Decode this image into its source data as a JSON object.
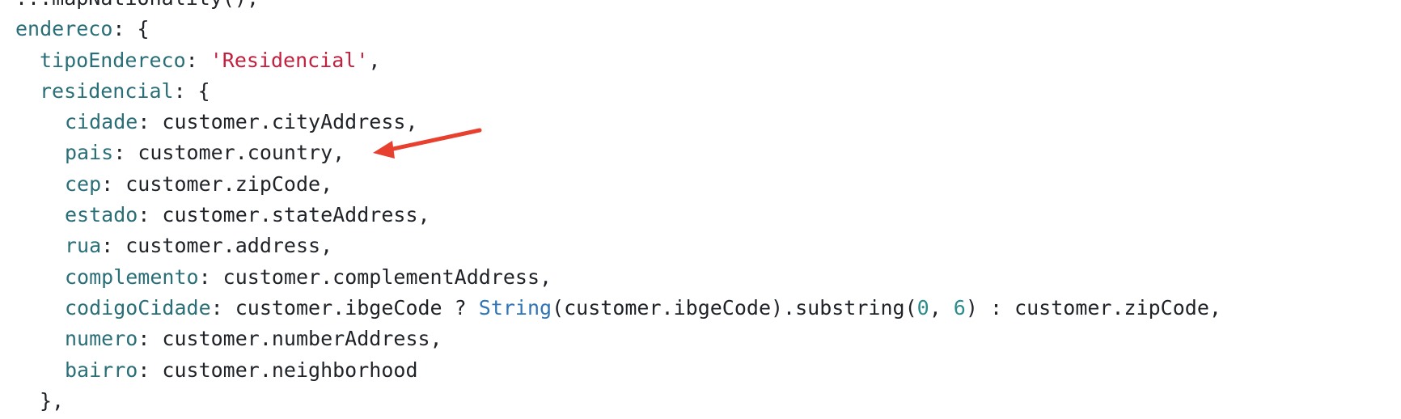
{
  "code_lines": [
    {
      "top_line": "...mapNationality(),"
    },
    {
      "key": "endereco",
      "rest": ": {"
    },
    {
      "key": "tipoEndereco",
      "sep": ": ",
      "string": "'Residencial'",
      "end": ","
    },
    {
      "key": "residencial",
      "rest": ": {"
    },
    {
      "key": "cidade",
      "rest": ": customer.cityAddress,"
    },
    {
      "key": "pais",
      "rest": ": customer.country,"
    },
    {
      "key": "cep",
      "rest": ": customer.zipCode,"
    },
    {
      "key": "estado",
      "rest": ": customer.stateAddress,"
    },
    {
      "key": "rua",
      "rest": ": customer.address,"
    },
    {
      "key": "complemento",
      "rest": ": customer.complementAddress,"
    },
    {
      "key": "codigoCidade",
      "part1": ": customer.ibgeCode ? ",
      "type": "String",
      "part2": "(customer.ibgeCode).substring(",
      "num1": "0",
      "comma": ", ",
      "num2": "6",
      "part3": ") : customer.zipCode,"
    },
    {
      "key": "numero",
      "rest": ": customer.numberAddress,"
    },
    {
      "key": "bairro",
      "rest": ": customer.neighborhood"
    },
    {
      "rest": "},"
    }
  ],
  "colors": {
    "property": "#2a6f78",
    "string": "#c3203f",
    "number": "#2a8c8c",
    "type": "#2f74b5",
    "text": "#1f2328",
    "arrow": "#e8402f"
  },
  "annotations": {
    "arrow_icon": "red-arrow-pointing-left"
  }
}
